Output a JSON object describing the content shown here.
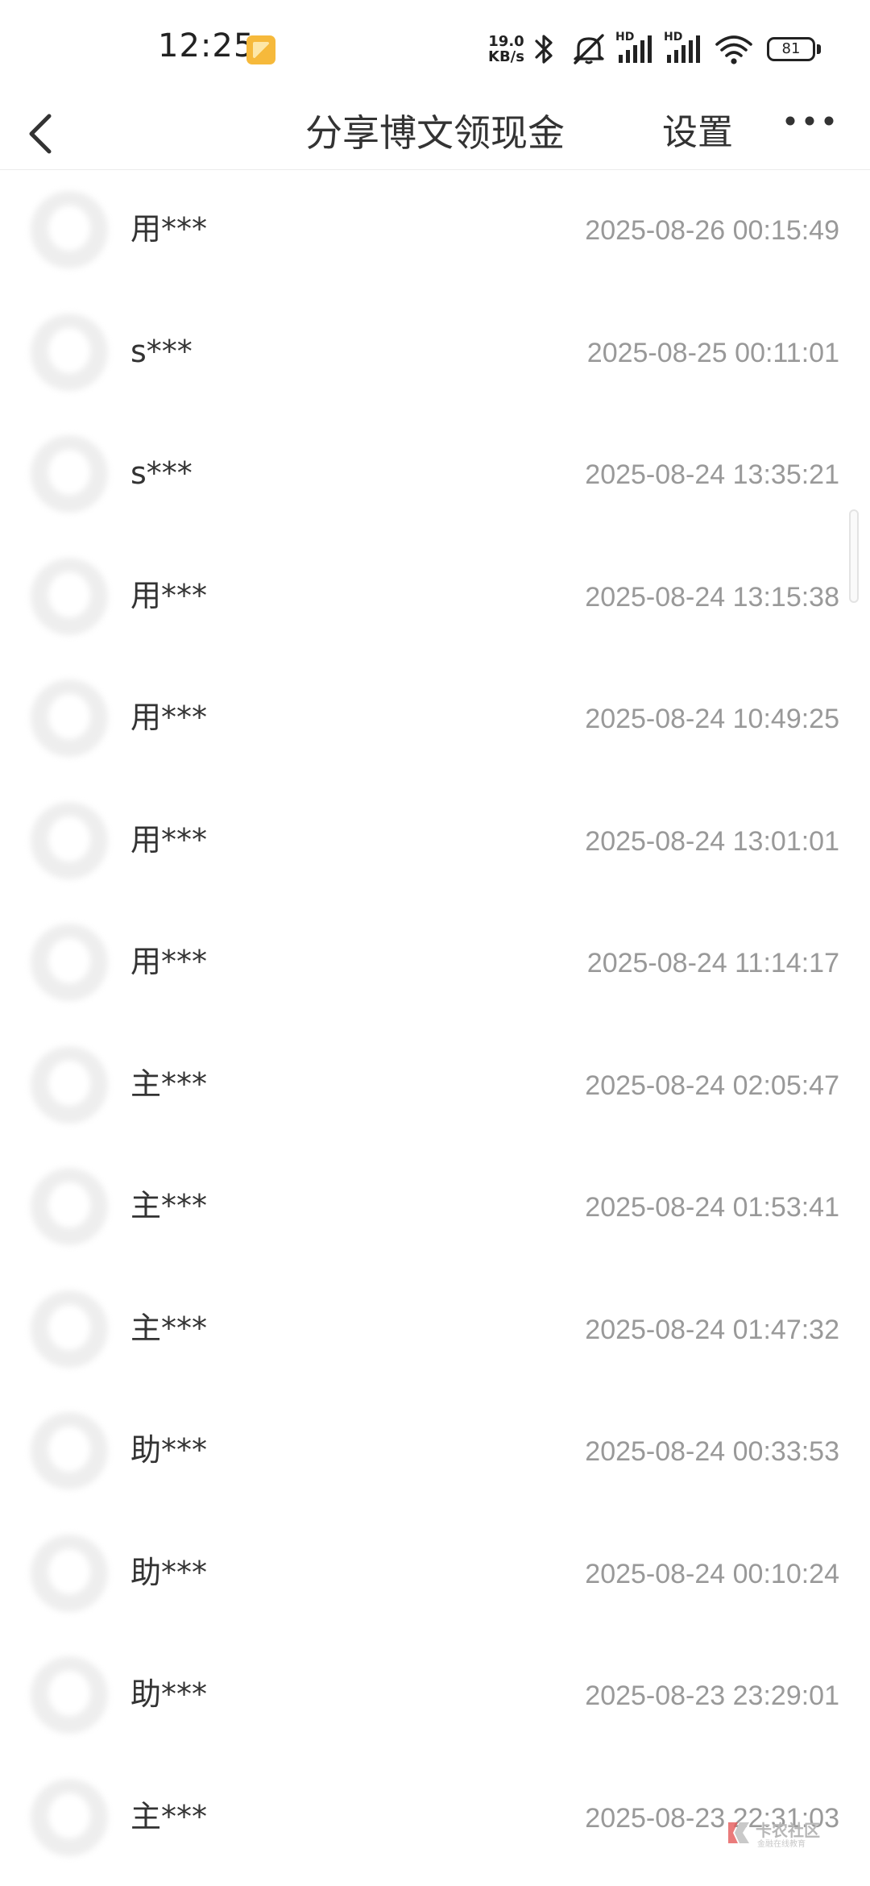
{
  "status_bar": {
    "time": "12:25",
    "net_speed_value": "19.0",
    "net_speed_unit": "KB/s",
    "signal_1_label": "HD",
    "signal_2_label": "HD",
    "battery": "81",
    "icons": [
      "notification-app-icon",
      "bluetooth-icon",
      "mute-icon",
      "signal-icon",
      "signal-icon",
      "wifi-icon",
      "battery-icon"
    ]
  },
  "header": {
    "title": "分享博文领现金",
    "settings_label": "设置",
    "back_icon": "chevron-left-icon",
    "more_icon": "more-dots-icon"
  },
  "records": [
    {
      "name": "用***",
      "time": "2025-08-26 00:15:49"
    },
    {
      "name": "s***",
      "time": "2025-08-25 00:11:01"
    },
    {
      "name": "s***",
      "time": "2025-08-24 13:35:21"
    },
    {
      "name": "用***",
      "time": "2025-08-24 13:15:38"
    },
    {
      "name": "用***",
      "time": "2025-08-24 10:49:25"
    },
    {
      "name": "用***",
      "time": "2025-08-24 13:01:01"
    },
    {
      "name": "用***",
      "time": "2025-08-24 11:14:17"
    },
    {
      "name": "主***",
      "time": "2025-08-24 02:05:47"
    },
    {
      "name": "主***",
      "time": "2025-08-24 01:53:41"
    },
    {
      "name": "主***",
      "time": "2025-08-24 01:47:32"
    },
    {
      "name": "助***",
      "time": "2025-08-24 00:33:53"
    },
    {
      "name": "助***",
      "time": "2025-08-24 00:10:24"
    },
    {
      "name": "助***",
      "time": "2025-08-23 23:29:01"
    },
    {
      "name": "主***",
      "time": "2025-08-23 22:31:03"
    }
  ],
  "watermark": {
    "text": "卡农社区",
    "subtext": "金融在线教育"
  }
}
